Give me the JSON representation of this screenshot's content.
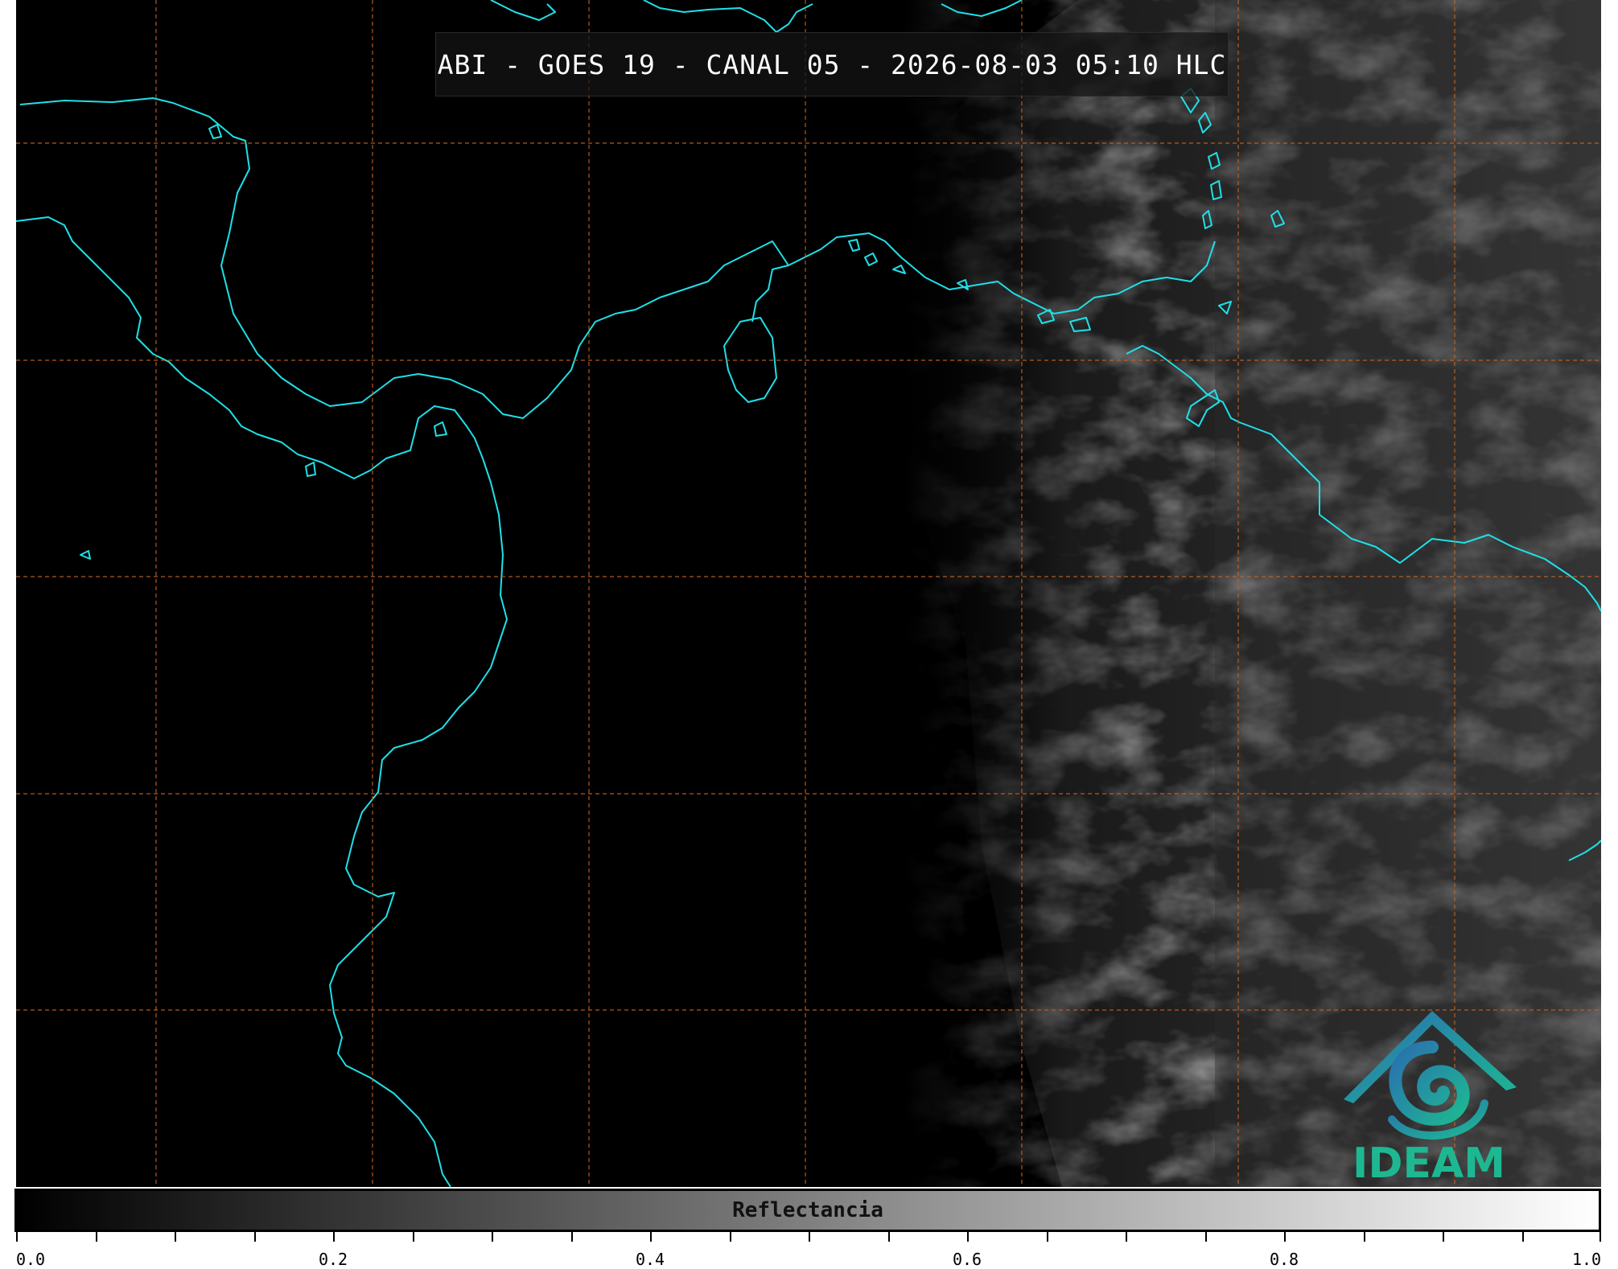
{
  "title": "ABI - GOES 19 - CANAL 05 - 2026-08-03 05:10 HLC",
  "logo": {
    "text": "IDEAM",
    "icon": "ideam-logo-icon",
    "colors": [
      "#2a6fb0",
      "#1db892"
    ]
  },
  "colorbar": {
    "label": "Reflectancia",
    "min": 0.0,
    "max": 1.0,
    "tick_labels": [
      "0.0",
      "0.2",
      "0.4",
      "0.6",
      "0.8",
      "1.0"
    ],
    "colors": [
      "#000000",
      "#ffffff"
    ]
  },
  "colors": {
    "grid": "#c8631f",
    "coastline": "#1fe0e8",
    "background": "#000000"
  }
}
